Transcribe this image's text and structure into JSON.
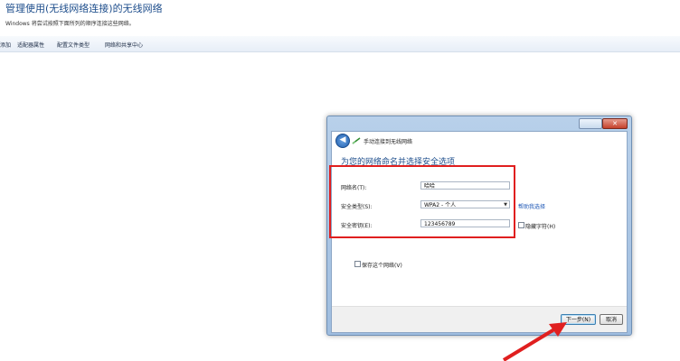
{
  "background": {
    "title": "管理使用(无线网络连接)的无线网络",
    "subtitle": "Windows 将尝试按照下面所列的顺序连接这些网络。",
    "toolbar": [
      "添加",
      "适配器属性",
      "配置文件类型",
      "网络和共享中心"
    ]
  },
  "dialog": {
    "close_label": "✕",
    "back_icon": "back-arrow-icon",
    "title": "手动连接到无线网络",
    "heading": "为您的网络命名并选择安全选项",
    "fields": {
      "network_name_label": "网络名(T):",
      "network_name_value": "哈哈",
      "security_type_label": "安全类型(S):",
      "security_type_value": "WPA2 - 个人",
      "security_key_label": "安全密钥(E):",
      "security_key_value": "123456789"
    },
    "help_link": "帮助我选择",
    "hide_chars_label": "隐藏字符(H)",
    "save_network_label": "保存这个网络(V)",
    "next_button": "下一步(N)",
    "cancel_button": "取消"
  },
  "colors": {
    "highlight": "#e01f1f",
    "heading": "#1e4e8c"
  }
}
